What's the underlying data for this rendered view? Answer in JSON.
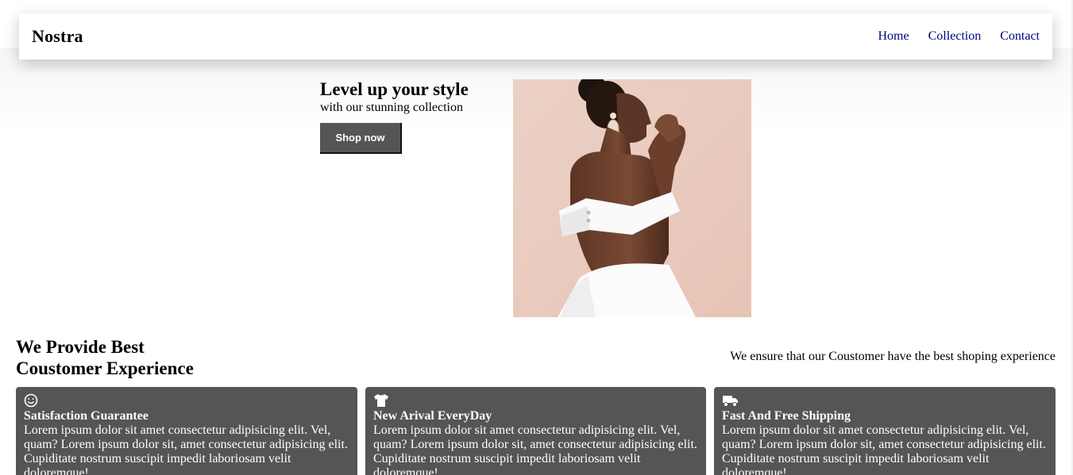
{
  "brand": {
    "name": "Nostra"
  },
  "nav": {
    "links": [
      "Home",
      "Collection",
      "Contact"
    ],
    "link_color": "#000080"
  },
  "hero": {
    "title": "Level up your style",
    "subtitle": "with our stunning collection",
    "button_label": "Shop now",
    "button_color": "#555555",
    "image_icon": "fashion-photo-woman-white-dress"
  },
  "features": {
    "title_line1": "We Provide Best",
    "title_line2": "Coustomer Experience",
    "description": "We ensure that our Coustomer have the best shoping experience",
    "card_color": "#555555",
    "cards": [
      {
        "icon": "smile-icon",
        "title": "Satisfaction Guarantee",
        "text": "Lorem ipsum dolor sit amet consectetur adipisicing elit. Vel, quam? Lorem ipsum dolor sit, amet consectetur adipisicing elit. Cupiditate nostrum suscipit impedit laboriosam velit doloremque!"
      },
      {
        "icon": "tshirt-icon",
        "title": "New Arival EveryDay",
        "text": "Lorem ipsum dolor sit amet consectetur adipisicing elit. Vel, quam? Lorem ipsum dolor sit, amet consectetur adipisicing elit. Cupiditate nostrum suscipit impedit laboriosam velit doloremque!"
      },
      {
        "icon": "truck-icon",
        "title": "Fast And Free Shipping",
        "text": "Lorem ipsum dolor sit amet consectetur adipisicing elit. Vel, quam? Lorem ipsum dolor sit, amet consectetur adipisicing elit. Cupiditate nostrum suscipit impedit laboriosam velit doloremque!"
      }
    ]
  }
}
